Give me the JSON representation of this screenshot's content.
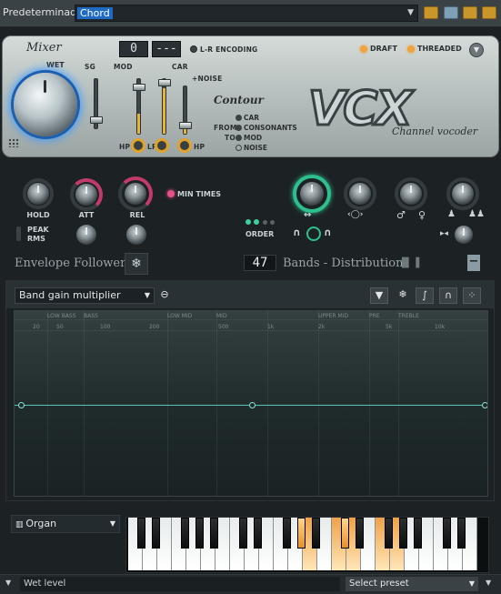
{
  "topbar": {
    "label": "Predeterminado:",
    "preset_value": "Chord",
    "icons": [
      "chevron-down-icon",
      "folder-icon",
      "save-icon",
      "open-folder-icon",
      "folder-icon"
    ]
  },
  "panel": {
    "mixer_title": "Mixer",
    "wet_label": "WET",
    "sg_label": "SG",
    "mod_label": "MOD",
    "car_label": "CAR",
    "noise_label": "+NOISE",
    "hp_label": "HP",
    "lp_label": "LP",
    "hp2_label": "HP",
    "lr_display": "0",
    "mode_display": "---",
    "lr_encoding_label": "L-R ENCODING",
    "draft_label": "DRAFT",
    "threaded_label": "THREADED",
    "contour_title": "Contour",
    "contour_options": [
      "CAR",
      "CONSONANTS",
      "MOD",
      "NOISE"
    ],
    "from_label": "FROM",
    "to_label": "TO",
    "logo": "VCX",
    "logo_sub": "Channel vocoder",
    "accent_blue": "#3e9bff",
    "accent_orange": "#e1a22a"
  },
  "controls": {
    "hold_label": "HOLD",
    "att_label": "ATT",
    "rel_label": "REL",
    "min_times_label": "MIN TIMES",
    "peak_label": "PEAK",
    "rms_label": "RMS",
    "order_label": "ORDER",
    "envelope_title": "Envelope Follower",
    "bands_count": "47",
    "bands_title": "Bands - Distribution",
    "accent_teal": "#2fbf8f",
    "accent_pink": "#c23a6a"
  },
  "editor": {
    "dropdown_value": "Band gain multiplier",
    "freq_labels_top": [
      "LOW BASS",
      "BASS",
      "LOW MID",
      "MID",
      "UPPER MID",
      "PRE",
      "TREBLE"
    ],
    "freq_labels_bottom": [
      "20",
      "50",
      "100",
      "200",
      "500",
      "1k",
      "2k",
      "5k",
      "10k"
    ]
  },
  "instrument": {
    "name": "Organ"
  },
  "status": {
    "hint": "Wet level",
    "select_preset": "Select preset"
  }
}
